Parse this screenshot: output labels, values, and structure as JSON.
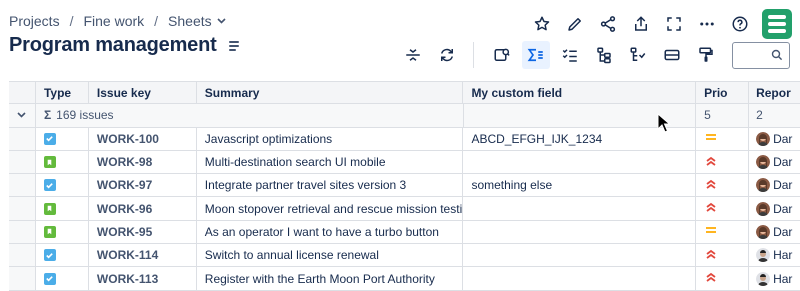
{
  "breadcrumb": {
    "projects": "Projects",
    "sep1": "/",
    "fine_work": "Fine work",
    "sep2": "/",
    "sheets": "Sheets"
  },
  "page_title": "Program management",
  "search": {
    "placeholder": ""
  },
  "colors": {
    "accent": "#0c66e4",
    "logo": "#22a06b",
    "task": "#4bade8",
    "story": "#63ba3c",
    "prio_medium": "#ffab00",
    "prio_high": "#e2483d"
  },
  "columns": {
    "type": "Type",
    "key": "Issue key",
    "summary": "Summary",
    "custom": "My custom field",
    "prio": "Prio",
    "reporter": "Repor"
  },
  "group": {
    "sigma": "Σ",
    "label": "169 issues",
    "prio_count": "5",
    "reporter_count": "2"
  },
  "rows": [
    {
      "type": "task",
      "key": "WORK-100",
      "summary": "Javascript optimizations",
      "custom": "ABCD_EFGH_IJK_1234",
      "prio": "medium",
      "reporter": "Dar",
      "avatar": "woman-avatar"
    },
    {
      "type": "story",
      "key": "WORK-98",
      "summary": "Multi-destination search UI mobile",
      "custom": "",
      "prio": "high",
      "reporter": "Dar",
      "avatar": "woman-avatar"
    },
    {
      "type": "task",
      "key": "WORK-97",
      "summary": "Integrate partner travel sites version 3",
      "custom": "something else",
      "prio": "high",
      "reporter": "Dar",
      "avatar": "woman-avatar"
    },
    {
      "type": "story",
      "key": "WORK-96",
      "summary": "Moon stopover retrieval and rescue mission testi…",
      "custom": "",
      "prio": "high",
      "reporter": "Dar",
      "avatar": "woman-avatar"
    },
    {
      "type": "story",
      "key": "WORK-95",
      "summary": "As an operator I want to have a turbo button",
      "custom": "",
      "prio": "medium",
      "reporter": "Dar",
      "avatar": "woman-avatar"
    },
    {
      "type": "task",
      "key": "WORK-114",
      "summary": "Switch to annual license renewal",
      "custom": "",
      "prio": "high",
      "reporter": "Har",
      "avatar": "man-avatar"
    },
    {
      "type": "task",
      "key": "WORK-113",
      "summary": "Register with the Earth Moon Port Authority",
      "custom": "",
      "prio": "high",
      "reporter": "Har",
      "avatar": "man-avatar"
    }
  ]
}
